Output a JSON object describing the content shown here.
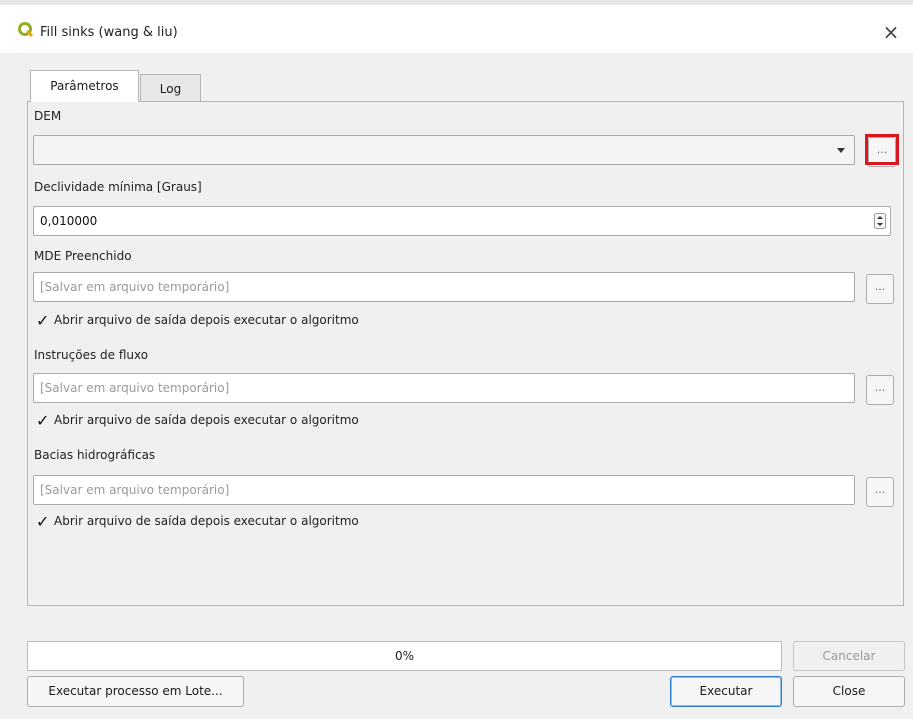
{
  "window": {
    "title": "Fill sinks (wang & liu)",
    "close_glyph": "×"
  },
  "tabs": [
    {
      "label": "Parâmetros",
      "active": true
    },
    {
      "label": "Log",
      "active": false
    }
  ],
  "params": {
    "dem": {
      "label": "DEM",
      "value": "",
      "browse_label": "..."
    },
    "min_slope": {
      "label": "Declividade mínima [Graus]",
      "value": "0,010000"
    },
    "filled_dem": {
      "label": "MDE Preenchido",
      "placeholder": "[Salvar em arquivo temporário]",
      "browse_label": "...",
      "open_output_label": "Abrir arquivo de saída depois executar o algoritmo",
      "open_output_checked": true
    },
    "flow_dir": {
      "label": "Instruções de fluxo",
      "placeholder": "[Salvar em arquivo temporário]",
      "browse_label": "...",
      "open_output_label": "Abrir arquivo de saída depois executar o algoritmo",
      "open_output_checked": true
    },
    "basins": {
      "label": "Bacias hidrográficas",
      "placeholder": "[Salvar em arquivo temporário]",
      "browse_label": "...",
      "open_output_label": "Abrir arquivo de saída depois executar o algoritmo",
      "open_output_checked": true
    }
  },
  "footer": {
    "progress_text": "0%",
    "progress_value": 0,
    "cancel_label": "Cancelar",
    "batch_label": "Executar processo em Lote...",
    "run_label": "Executar",
    "close_label": "Close"
  },
  "colors": {
    "highlight": "#d8171f",
    "qgis_green": "#93b023",
    "default_button_border": "#2d7dd2"
  },
  "icons": {
    "app": "qgis-logo-icon",
    "checkbox": "check-mark",
    "spin": "spin-arrows"
  }
}
